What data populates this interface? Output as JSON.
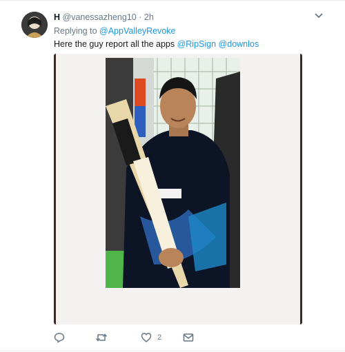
{
  "tweet": {
    "display_name": "H",
    "handle": "@vanessazheng10",
    "separator": "·",
    "time": "2h",
    "replying_prefix": "Replying to",
    "replying_to": "@AppValleyRevoke",
    "text_main": "Here the guy report all the apps",
    "mention_1": "@RipSign",
    "mention_2": "@downlos"
  },
  "actions": {
    "reply_icon": "reply-icon",
    "retweet_icon": "retweet-icon",
    "like_icon": "heart-icon",
    "like_count": "2",
    "dm_icon": "envelope-icon"
  },
  "colors": {
    "link": "#1b95e0",
    "muted": "#657786",
    "text": "#14171a"
  }
}
